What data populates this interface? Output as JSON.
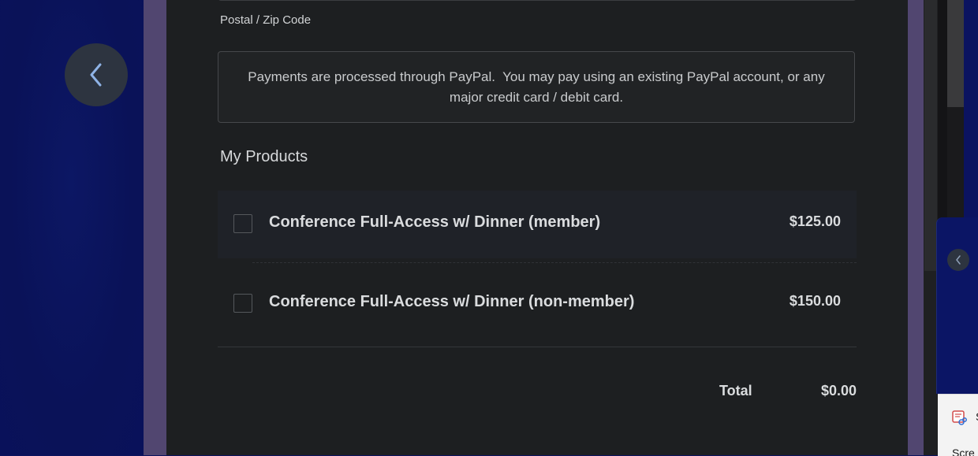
{
  "form": {
    "zip_label": "Postal / Zip Code",
    "payment_notice": "Payments are processed through PayPal.  You may pay using an existing PayPal account, or any major credit card / debit card."
  },
  "products": {
    "section_title": "My Products",
    "items": [
      {
        "name": "Conference Full-Access w/ Dinner (member)",
        "price": "$125.00",
        "checked": false
      },
      {
        "name": "Conference Full-Access w/ Dinner (non-member)",
        "price": "$150.00",
        "checked": false
      }
    ]
  },
  "summary": {
    "total_label": "Total",
    "total_value": "$0.00"
  },
  "snip_popup": {
    "title": "S",
    "subtitle": "Scre"
  },
  "colors": {
    "background": "#0b1360",
    "panel": "#1d1f21",
    "accent_purple": "#514670"
  },
  "icons": {
    "back": "chevron-left-icon",
    "side_back": "chevron-left-icon",
    "snip": "snipping-tool-icon"
  }
}
